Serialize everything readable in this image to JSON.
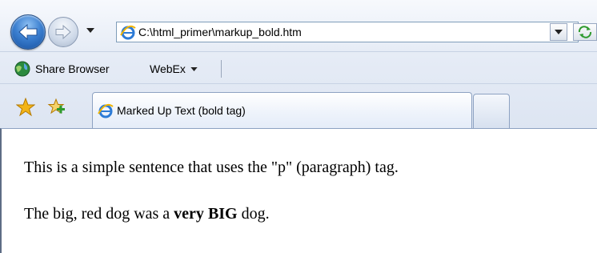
{
  "toolbar": {
    "address_url": "C:\\html_primer\\markup_bold.htm"
  },
  "links_bar": {
    "share_browser_label": "Share Browser",
    "webex_label": "WebEx"
  },
  "tabs": {
    "active_title": "Marked Up Text (bold tag)"
  },
  "content": {
    "paragraph_1": "This is a simple sentence that uses the \"p\" (paragraph) tag.",
    "paragraph_2_before": "The big, red dog was a",
    "paragraph_2_bold_very": "very",
    "paragraph_2_bold_big": "BIG",
    "paragraph_2_after": "dog."
  },
  "icons": {
    "back": "back-arrow-icon",
    "forward": "forward-arrow-icon",
    "history": "chevron-down-icon",
    "page": "ie-logo-icon",
    "refresh": "refresh-icon",
    "share_browser": "globe-icon",
    "favorites": "favorites-star-icon",
    "add_favorites": "add-favorites-icon"
  },
  "colors": {
    "chrome_bg": "#e6ecf6",
    "back_button": "#3b7fd0",
    "refresh_green": "#2e9a2e",
    "favorites_star": "#f2b418"
  }
}
